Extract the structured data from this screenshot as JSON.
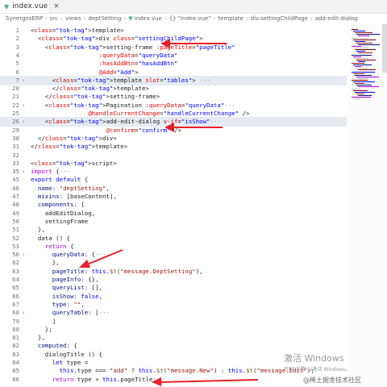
{
  "tab": {
    "label": "index.vue",
    "close_glyph": "×"
  },
  "breadcrumb": [
    {
      "label": "SynergosERP"
    },
    {
      "label": "src"
    },
    {
      "label": "views"
    },
    {
      "label": "deptSetting"
    },
    {
      "label": "index.vue",
      "icon": "vue-icon"
    },
    {
      "label": "{} \"index.vue\""
    },
    {
      "label": "template"
    },
    {
      "label": "div.settingChildPage"
    },
    {
      "label": "add-edit-dialog"
    }
  ],
  "colors": {
    "arrow": "#e8202a",
    "accent": "#41b883"
  },
  "editor": {
    "lines": [
      {
        "n": "1",
        "fold": "",
        "code": "<template>"
      },
      {
        "n": "2",
        "fold": "",
        "code": "  <div class=\"settingChildPage\">"
      },
      {
        "n": "3",
        "fold": "",
        "code": "    <setting-frame :pageTitle=\"pageTitle\""
      },
      {
        "n": "4",
        "fold": "",
        "code": "                   :queryData=\"queryData\""
      },
      {
        "n": "5",
        "fold": "",
        "code": "                   :hasAddBtn=\"hasAddBtn\""
      },
      {
        "n": "6",
        "fold": "",
        "code": "                   @Add=\"Add\">"
      },
      {
        "n": "7",
        "fold": ">",
        "code": "      <template slot=\"tables\"> ···",
        "hl": true
      },
      {
        "n": "20",
        "fold": "",
        "code": "      </template>"
      },
      {
        "n": "21",
        "fold": "",
        "code": "    </setting-frame>"
      },
      {
        "n": "22",
        "fold": ">",
        "code": "    <Pagination :queryData=\"queryData\"···"
      },
      {
        "n": "25",
        "fold": "",
        "code": "                @handleCurrentChange=\"handleCurrentChange\" />"
      },
      {
        "n": "26",
        "fold": ">",
        "code": "    <add-edit-dialog v-if=\"isShow\"···",
        "hl": true
      },
      {
        "n": "29",
        "fold": "",
        "code": "                     @confirm=\"confirm\" />"
      },
      {
        "n": "30",
        "fold": "",
        "code": "  </div>"
      },
      {
        "n": "31",
        "fold": "",
        "code": "</template>"
      },
      {
        "n": "32",
        "fold": "",
        "code": ""
      },
      {
        "n": "33",
        "fold": "",
        "code": "<script>"
      },
      {
        "n": "35",
        "fold": ">",
        "code": "import {···"
      },
      {
        "n": "45",
        "fold": "",
        "code": "export default {"
      },
      {
        "n": "46",
        "fold": "",
        "code": "  name: \"deptSetting\","
      },
      {
        "n": "47",
        "fold": "",
        "code": "  mixins: [baseContent],"
      },
      {
        "n": "48",
        "fold": "",
        "code": "  components: {"
      },
      {
        "n": "49",
        "fold": "",
        "code": "    addEditDialog,"
      },
      {
        "n": "50",
        "fold": "",
        "code": "    settingFrame"
      },
      {
        "n": "51",
        "fold": "",
        "code": "  },"
      },
      {
        "n": "52",
        "fold": "",
        "code": "  data () {"
      },
      {
        "n": "53",
        "fold": "",
        "code": "    return {"
      },
      {
        "n": "56",
        "fold": ">",
        "code": "      queryData: {···"
      },
      {
        "n": "62",
        "fold": "",
        "code": "      },"
      },
      {
        "n": "63",
        "fold": "",
        "code": "      pageTitle: this.$t(\"message.DeptSetting\"),"
      },
      {
        "n": "64",
        "fold": "",
        "code": "      pageInfo: {},"
      },
      {
        "n": "65",
        "fold": "",
        "code": "      queryList: [],"
      },
      {
        "n": "66",
        "fold": "",
        "code": "      isShow: false,"
      },
      {
        "n": "67",
        "fold": "",
        "code": "      type: \"\","
      },
      {
        "n": "68",
        "fold": ">",
        "code": "      queryTable: [···"
      },
      {
        "n": "79",
        "fold": "",
        "code": "      ]"
      },
      {
        "n": "80",
        "fold": "",
        "code": "    };"
      },
      {
        "n": "81",
        "fold": "",
        "code": "  },"
      },
      {
        "n": "82",
        "fold": "",
        "code": "  computed: {"
      },
      {
        "n": "83",
        "fold": "",
        "code": "    dialogTitle () {"
      },
      {
        "n": "84",
        "fold": "",
        "code": "      let type ="
      },
      {
        "n": "85",
        "fold": "",
        "code": "        this.type === \"add\" ? this.$t(\"message.New\") : this.$t(\"message.Edit\");"
      },
      {
        "n": "86",
        "fold": "",
        "code": "      return type + this.pageTitle;"
      }
    ]
  },
  "watermark": {
    "title": "激活 Windows",
    "subtitle": "转到\"设置\"以激活 Windows。"
  },
  "site_mark": "@稀土掘金技术社区"
}
